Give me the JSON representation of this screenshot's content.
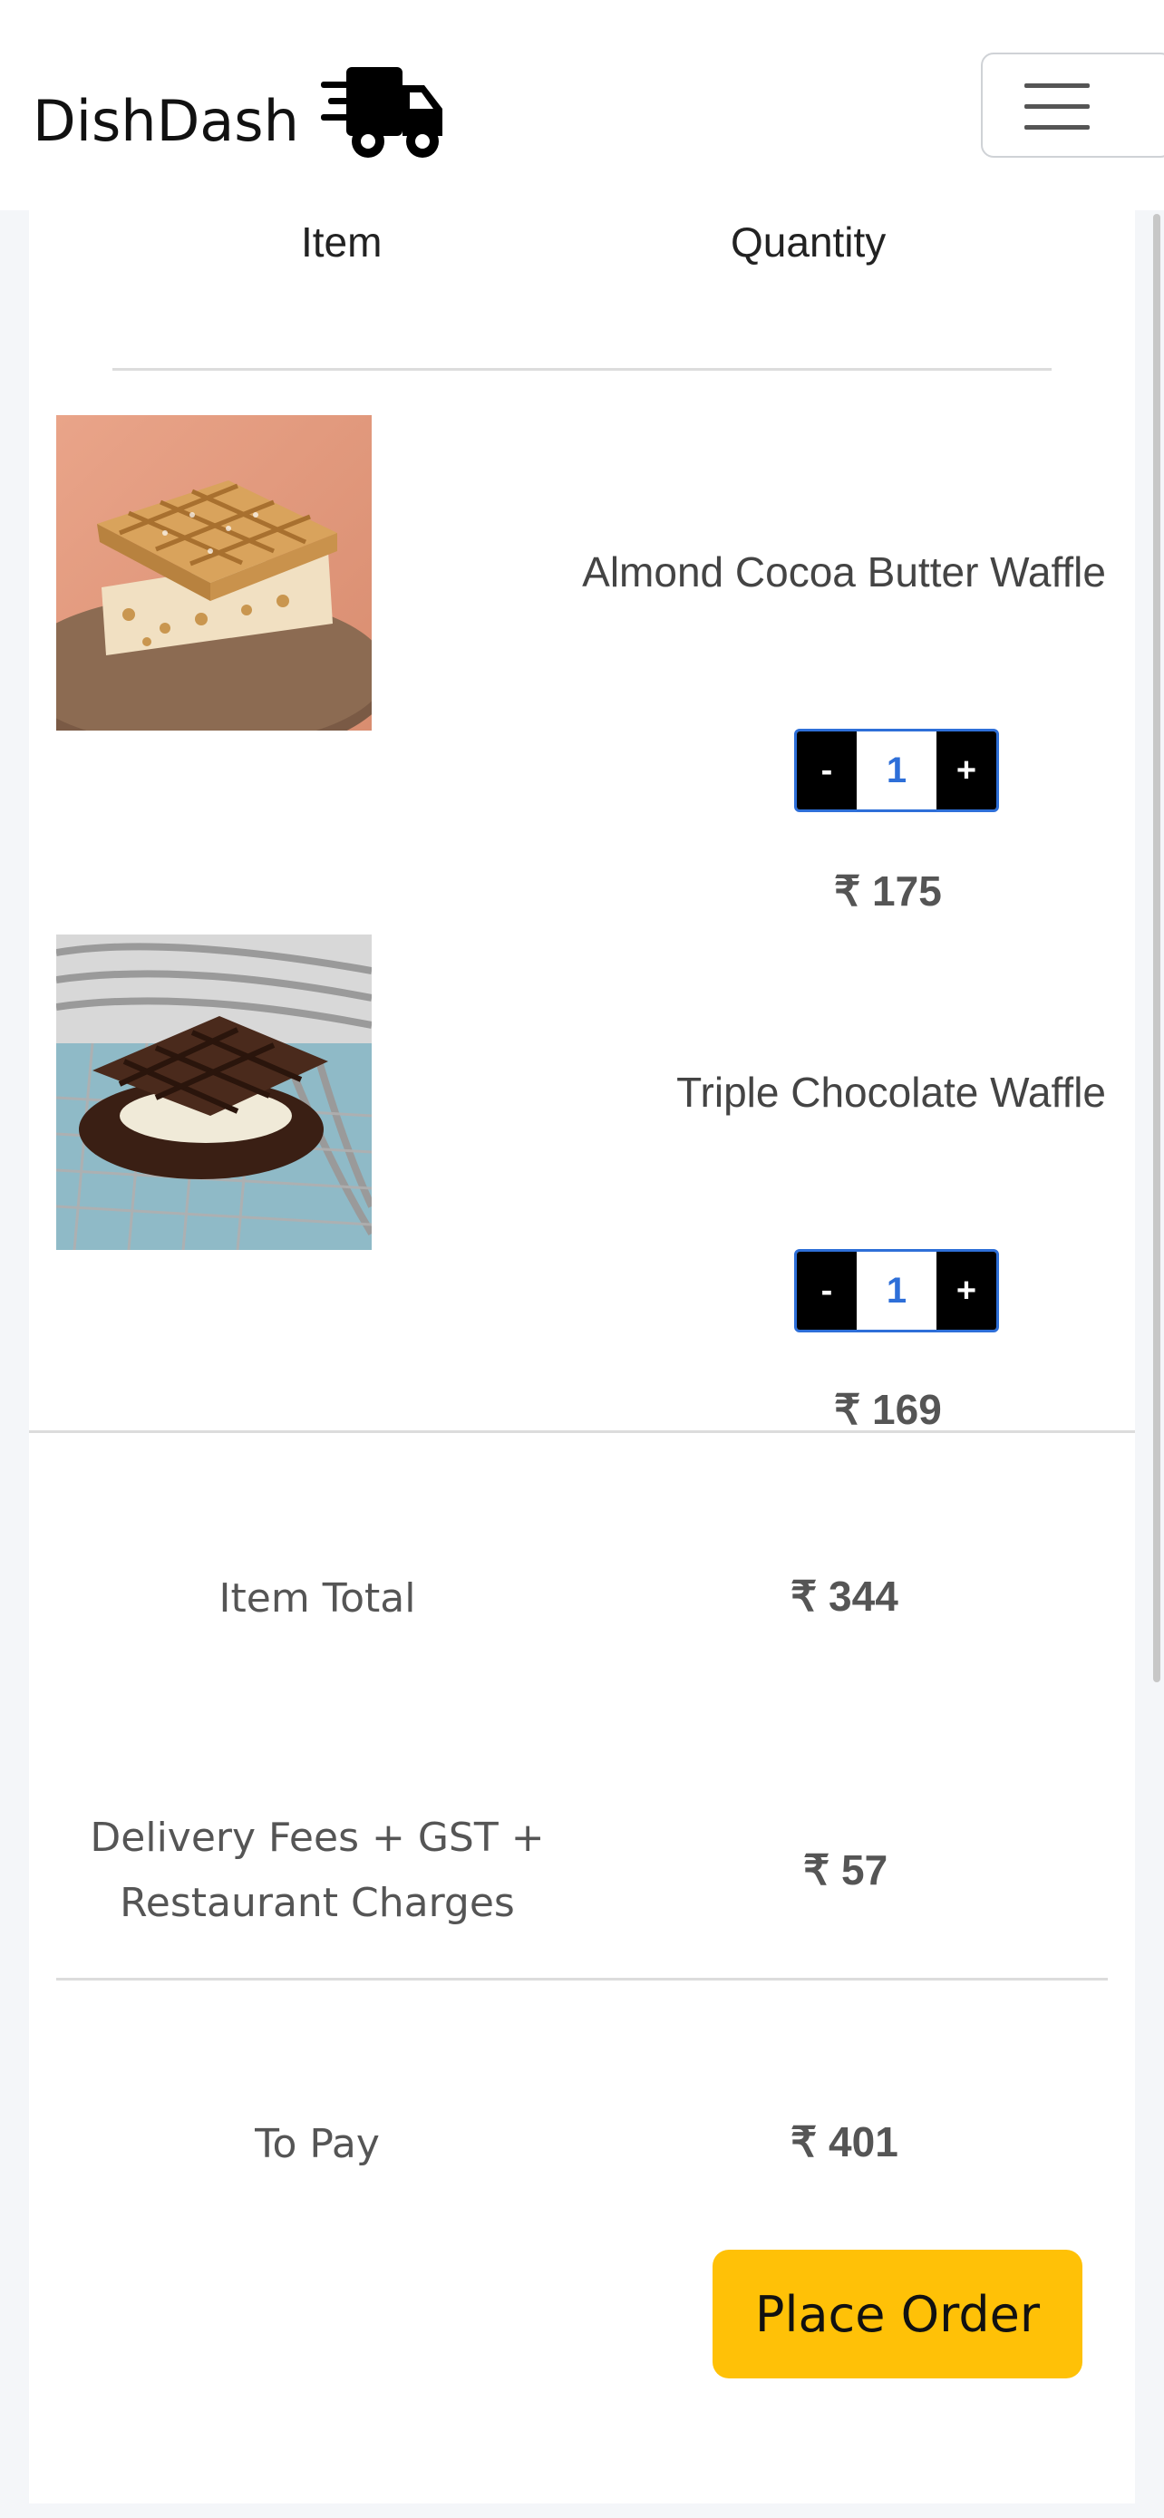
{
  "brand": {
    "name": "DishDash",
    "logo_icon": "delivery-truck-icon"
  },
  "navbar": {
    "toggle_icon": "hamburger-menu-icon"
  },
  "cart": {
    "columns": {
      "item": "Item",
      "quantity": "Quantity"
    },
    "items": [
      {
        "name": "Almond Cocoa Butter Waffle",
        "quantity": "1",
        "decrement": "-",
        "increment": "+",
        "price": "₹ 175"
      },
      {
        "name": "Triple Chocolate Waffle",
        "quantity": "1",
        "decrement": "-",
        "increment": "+",
        "price": "₹ 169"
      }
    ]
  },
  "summary": {
    "item_total_label": "Item Total",
    "item_total_value": "₹ 344",
    "fees_label_line1": "Delivery Fees + GST +",
    "fees_label_line2": "Restaurant Charges",
    "fees_value": "₹ 57",
    "to_pay_label": "To Pay",
    "to_pay_value": "₹ 401"
  },
  "actions": {
    "place_order": "Place Order"
  },
  "colors": {
    "accent": "#ffc107",
    "qty_border": "#2e6fd8",
    "qty_button": "#000000"
  }
}
